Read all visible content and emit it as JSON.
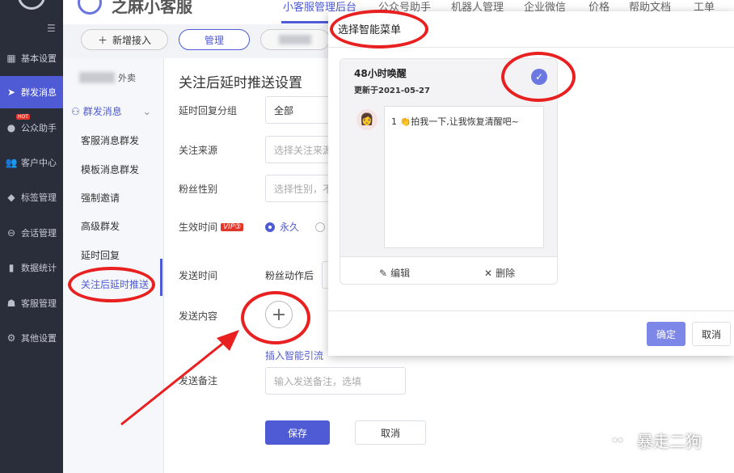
{
  "header": {
    "brand": "之麻小客服",
    "tabs": [
      "小客服管理后台",
      "公众号助手",
      "机器人管理",
      "企业微信",
      "价格",
      "帮助文档",
      "工单"
    ]
  },
  "toolbar": {
    "add_label": "新增接入",
    "manage_label": "管理"
  },
  "sidebar": {
    "items": [
      {
        "label": "基本设置",
        "icon": "grid-icon"
      },
      {
        "label": "群发消息",
        "icon": "send-icon",
        "active": true
      },
      {
        "label": "公众助手",
        "icon": "wechat-icon",
        "badge": "HOT"
      },
      {
        "label": "客户中心",
        "icon": "users-icon"
      },
      {
        "label": "标签管理",
        "icon": "tag-icon"
      },
      {
        "label": "会话管理",
        "icon": "chat-icon"
      },
      {
        "label": "数据统计",
        "icon": "bar-chart-icon"
      },
      {
        "label": "客服管理",
        "icon": "robot-icon"
      },
      {
        "label": "其他设置",
        "icon": "gear-icon"
      }
    ]
  },
  "submenu": {
    "account": "外卖",
    "group": "群发消息",
    "items": [
      "客服消息群发",
      "模板消息群发",
      "强制邀请",
      "高级群发",
      "延时回复",
      "关注后延时推送"
    ]
  },
  "main": {
    "title": "关注后延时推送设置",
    "delay_group_label": "延时回复分组",
    "delay_group_value": "全部",
    "source_label": "关注来源",
    "source_placeholder": "选择关注来源",
    "gender_label": "粉丝性别",
    "gender_placeholder": "选择性别，不",
    "effective_label": "生效时间",
    "vip_badge": "VIP③",
    "effective_value": "永久",
    "send_time_label": "发送时间",
    "send_time_value": "粉丝动作后",
    "content_label": "发送内容",
    "plus": "+",
    "insert_link": "插入智能引流",
    "remark_label": "发送备注",
    "remark_placeholder": "输入发送备注，选填",
    "save_label": "保存",
    "cancel_label": "取消"
  },
  "modal": {
    "title": "选择智能菜单",
    "card": {
      "name": "48小时唤醒",
      "date": "更新于2021-05-27",
      "message": "1 👏拍我一下,让我恢复清醒吧~",
      "edit_label": "编辑",
      "delete_label": "删除"
    },
    "confirm_label": "确定",
    "cancel_label": "取消"
  },
  "watermark": {
    "text": "暴走二狗"
  },
  "colors": {
    "accent": "#4f5bd5",
    "sidebar_bg": "#2a2d3a",
    "annotation": "#e82020"
  }
}
